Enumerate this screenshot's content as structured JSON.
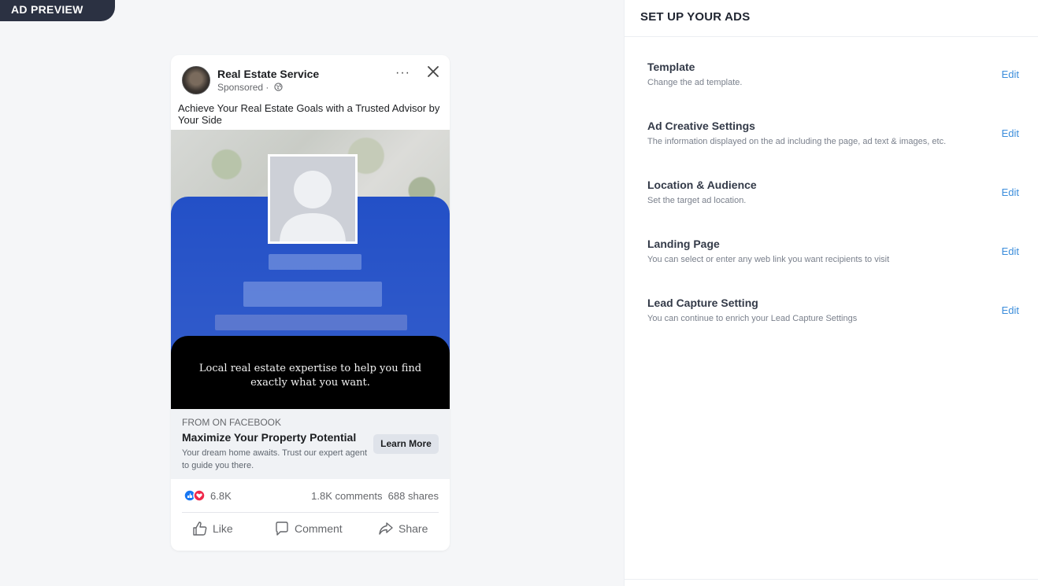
{
  "preview_tag": "AD PREVIEW",
  "setup": {
    "title": "SET UP YOUR ADS",
    "sections": [
      {
        "title": "Template",
        "desc": "Change the ad template.",
        "edit": "Edit"
      },
      {
        "title": "Ad Creative Settings",
        "desc": "The information displayed on the ad including the page, ad text & images, etc.",
        "edit": "Edit"
      },
      {
        "title": "Location & Audience",
        "desc": "Set the target ad location.",
        "edit": "Edit"
      },
      {
        "title": "Landing Page",
        "desc": "You can select or enter any web link you want recipients to visit",
        "edit": "Edit"
      },
      {
        "title": "Lead Capture Setting",
        "desc": "You can continue to enrich your Lead Capture Settings",
        "edit": "Edit"
      }
    ]
  },
  "ad": {
    "page_name": "Real Estate Service",
    "sponsored": "Sponsored ·",
    "more": "···",
    "caption": "Achieve Your Real Estate Goals with a Trusted Advisor by Your Side",
    "tagline": "Local real estate expertise to help you find exactly what you want.",
    "from": "FROM ON FACEBOOK",
    "headline": "Maximize Your Property Potential",
    "description": "Your dream home awaits. Trust our expert agent to guide you there.",
    "cta": "Learn More",
    "reactions": "6.8K",
    "comments_shares": "1.8K comments  688 shares",
    "actions": {
      "like": "Like",
      "comment": "Comment",
      "share": "Share"
    },
    "colors": {
      "blue_panel": "#2350c7",
      "like": "#1877f2",
      "love": "#f0284a"
    }
  }
}
